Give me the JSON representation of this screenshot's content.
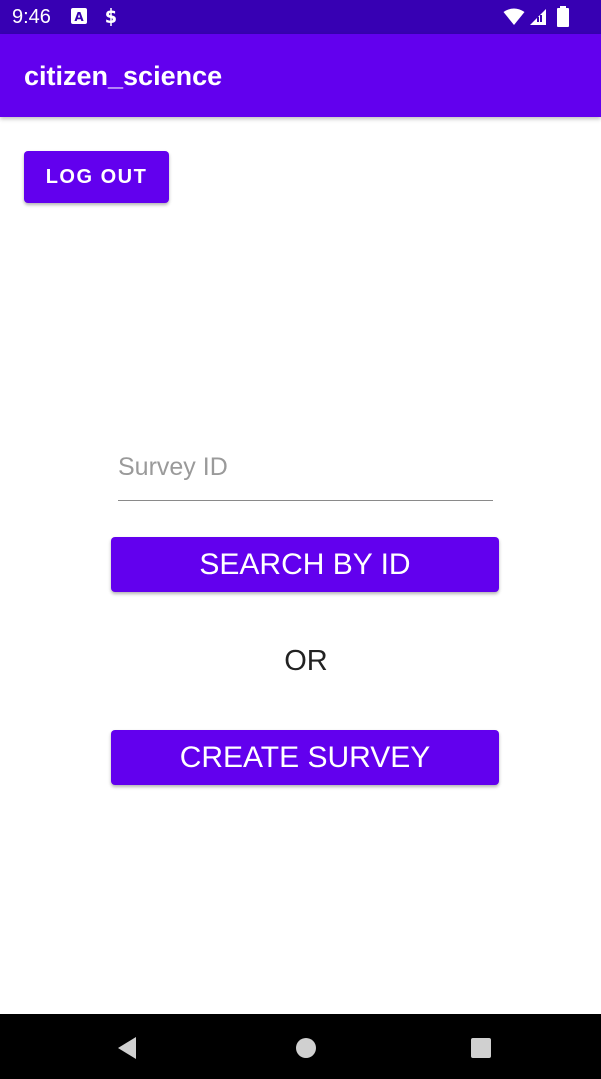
{
  "status_bar": {
    "time": "9:46",
    "icons": [
      "notification-a-icon",
      "notification-s-icon",
      "wifi-icon",
      "cellular-icon",
      "battery-icon"
    ]
  },
  "app_bar": {
    "title": "citizen_science"
  },
  "toolbar": {
    "logout_label": "LOG OUT"
  },
  "search": {
    "placeholder": "Survey ID",
    "value": "",
    "button_label": "SEARCH BY ID"
  },
  "divider_text": "OR",
  "create": {
    "button_label": "CREATE SURVEY"
  },
  "nav_bar": {
    "buttons": [
      "back-icon",
      "home-icon",
      "recents-icon"
    ]
  },
  "colors": {
    "status_bar": "#3700b3",
    "primary": "#6200ee",
    "background": "#ffffff",
    "nav_bar": "#000000"
  }
}
